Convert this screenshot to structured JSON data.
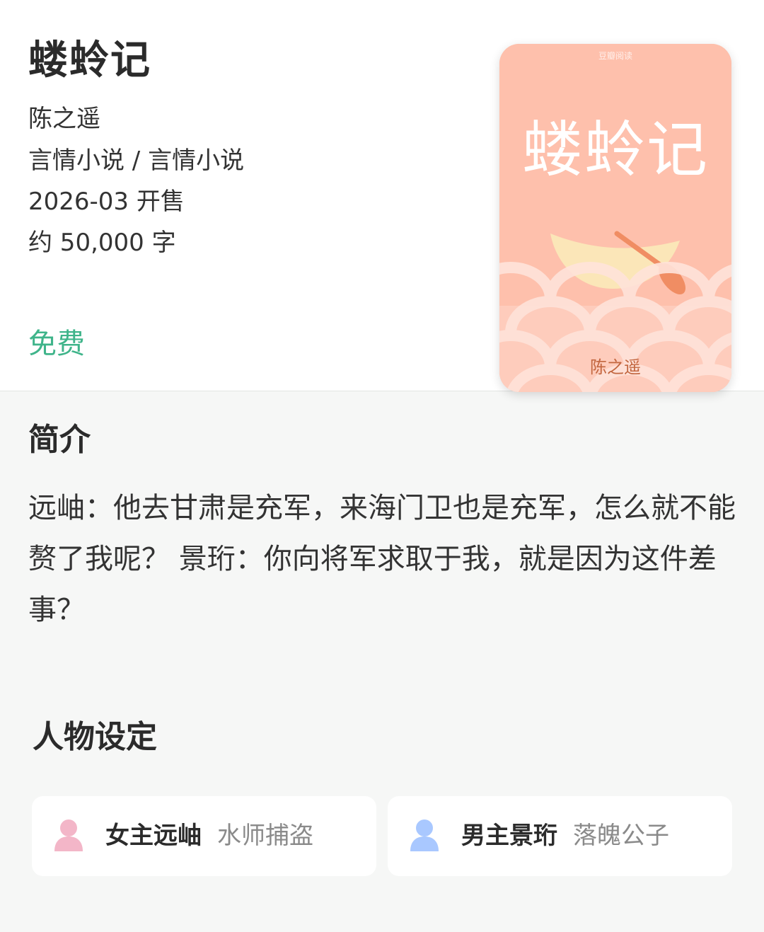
{
  "book": {
    "title": "蝼蛉记",
    "author": "陈之遥",
    "category": "言情小说 / 言情小说",
    "release": "2026-03 开售",
    "words": "约 50,000 字",
    "price": "免费"
  },
  "cover": {
    "title": "蝼蛉记",
    "author": "陈之遥",
    "brand": "豆瓣阅读",
    "colors": {
      "background": "#fec0ac",
      "moon": "#fbe6b8",
      "oar": "#f08d63",
      "waves": "#ffe3da"
    }
  },
  "intro": {
    "heading": "简介",
    "text": "远岫：他去甘肃是充军，来海门卫也是充军，怎么就不能赘了我呢？ 景珩：你向将军求取于我，就是因为这件差事？"
  },
  "characters": {
    "heading": "人物设定",
    "items": [
      {
        "name": "女主远岫",
        "role": "水师捕盗",
        "avatar_icon": "female-avatar-icon",
        "color": "#f3b6c8"
      },
      {
        "name": "男主景珩",
        "role": "落魄公子",
        "avatar_icon": "male-avatar-icon",
        "color": "#a9c8ff"
      }
    ]
  },
  "theme": {
    "accent": "#3fb48a"
  }
}
